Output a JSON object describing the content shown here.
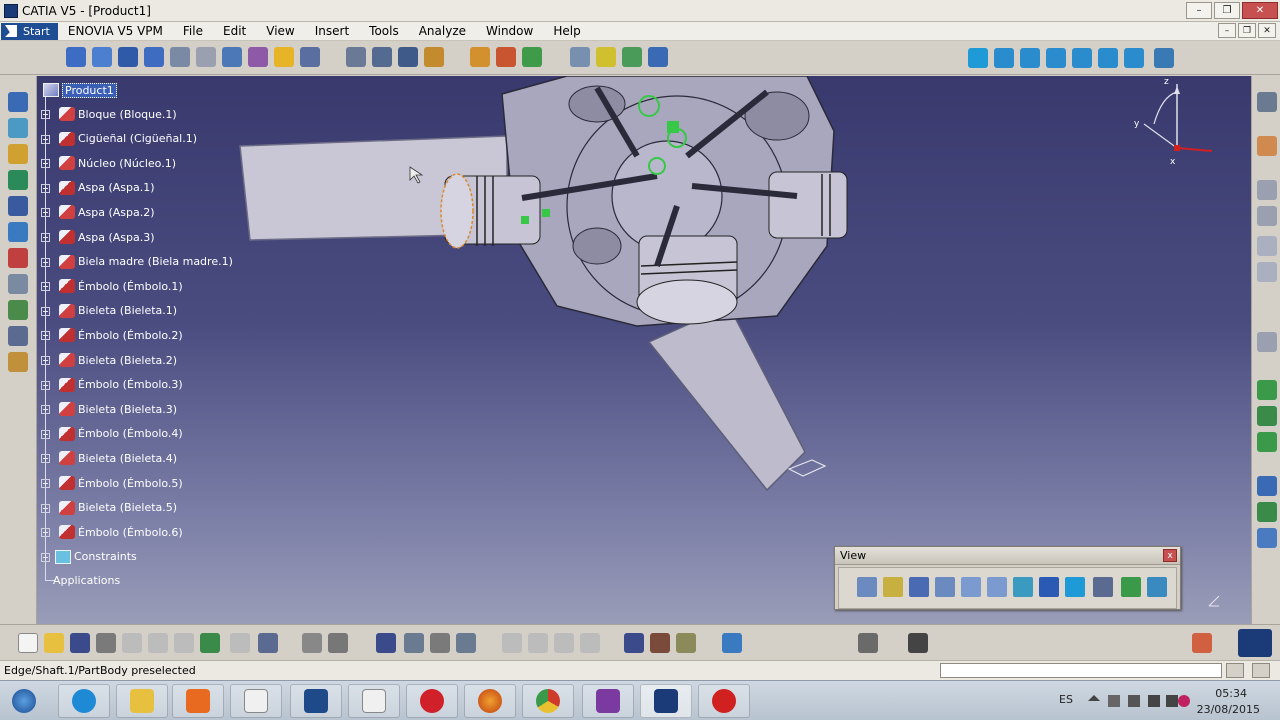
{
  "window": {
    "title": "CATIA V5 - [Product1]",
    "controls": {
      "minimize": "–",
      "restore": "❐",
      "close": "✕"
    }
  },
  "menubar": {
    "start": "Start",
    "items": [
      "ENOVIA V5 VPM",
      "File",
      "Edit",
      "View",
      "Insert",
      "Tools",
      "Analyze",
      "Window",
      "Help"
    ]
  },
  "tree": {
    "root": "Product1",
    "items": [
      "Bloque (Bloque.1)",
      "Cigüeñal (Cigüeñal.1)",
      "Núcleo (Núcleo.1)",
      "Aspa (Aspa.1)",
      "Aspa (Aspa.2)",
      "Aspa (Aspa.3)",
      "Biela madre (Biela madre.1)",
      "Émbolo (Émbolo.1)",
      "Bieleta (Bieleta.1)",
      "Émbolo (Émbolo.2)",
      "Bieleta (Bieleta.2)",
      "Émbolo (Émbolo.3)",
      "Bieleta (Bieleta.3)",
      "Émbolo (Émbolo.4)",
      "Bieleta (Bieleta.4)",
      "Émbolo (Émbolo.5)",
      "Bieleta (Bieleta.5)",
      "Émbolo (Émbolo.6)"
    ],
    "constraints": "Constraints",
    "applications": "Applications"
  },
  "compass": {
    "x_label": "x",
    "y_label": "y",
    "z_label": "z"
  },
  "view_toolbar": {
    "title": "View",
    "close": "x"
  },
  "status": {
    "text": "Edge/Shaft.1/PartBody preselected"
  },
  "taskbar": {
    "language": "ES",
    "time": "05:34",
    "date": "23/08/2015"
  },
  "colors": {
    "viewport_top": "#39396e",
    "viewport_bottom": "#9a9db8",
    "selection": "#3a5fb5",
    "start_button": "#1e4d94"
  }
}
